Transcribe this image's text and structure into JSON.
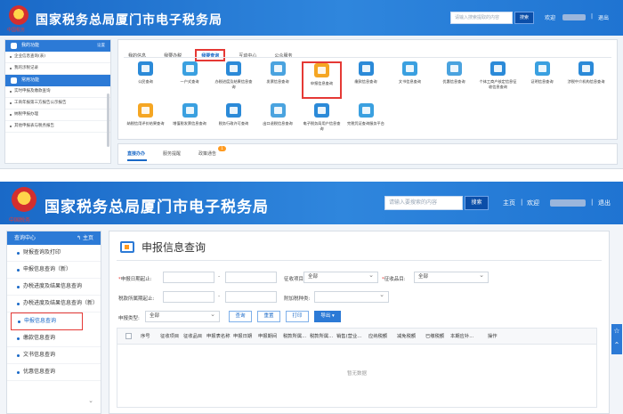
{
  "screenshot1": {
    "header": {
      "title": "国家税务总局厦门市电子税务局",
      "emblem_caption": "中国税务",
      "search_placeholder": "请输入搜索提取的内容",
      "search_button": "搜索",
      "welcome": "欢迎",
      "separator": "|",
      "logout": "退出"
    },
    "sidebar": {
      "section1_title": "我的功能",
      "section1_more": "设置",
      "section1_items": [
        "企业信息查询(表)",
        "我的涉税记录"
      ],
      "section2_title": "常用功能",
      "section2_items": [
        "实时申报及缴款查询",
        "工商年报第三方报告公示报告",
        "纳税申报办理",
        "其他申报表与税务报告"
      ]
    },
    "tabs": [
      "我的信息",
      "我要办税",
      "我要查询",
      "互动中心",
      "公众服务"
    ],
    "active_tab": "我要查询",
    "tiles": [
      {
        "label": "公民查询",
        "color": "#2b8ad8"
      },
      {
        "label": "一户式查询",
        "color": "#3aa0e0"
      },
      {
        "label": "办税进度及结果信息查询",
        "color": "#2b8ad8"
      },
      {
        "label": "发票信息查询",
        "color": "#4aa3df"
      },
      {
        "label": "申报信息查询",
        "color": "#f5a623"
      },
      {
        "label": "缴款信息查询",
        "color": "#2b8ad8"
      },
      {
        "label": "文书信息查询",
        "color": "#3aa0e0"
      },
      {
        "label": "优惠信息查询",
        "color": "#4aa3df"
      },
      {
        "label": "个体工商户核定信息征收信息查询",
        "color": "#2b8ad8"
      },
      {
        "label": "证明信息查询",
        "color": "#3aa0e0"
      },
      {
        "label": "涉税中介机构信息查询",
        "color": "#2b8ad8"
      },
      {
        "label": "纳税信用评价结果查询",
        "color": "#f5a623"
      },
      {
        "label": "增值税发票信息查询",
        "color": "#3aa0e0"
      },
      {
        "label": "税务行政许可查询",
        "color": "#2b8ad8"
      },
      {
        "label": "出口退税信息查询",
        "color": "#4aa3df"
      },
      {
        "label": "电子税务局用户信息查询",
        "color": "#2b8ad8"
      },
      {
        "label": "完税凭证查询服务平台",
        "color": "#3aa0e0"
      }
    ],
    "highlighted_tile": "申报信息查询",
    "bottom_tabs": [
      "直接办办",
      "服务提醒",
      "政策通告"
    ],
    "bottom_badge": "1"
  },
  "screenshot2": {
    "header": {
      "title": "国家税务总局厦门市电子税务局",
      "emblem_caption": "中国税务",
      "search_placeholder": "请输入要搜索的内容",
      "search_button": "搜索",
      "home": "主页",
      "separator": "|",
      "welcome": "欢迎",
      "logout": "退出"
    },
    "sidebar": {
      "title": "查询中心",
      "home": "主页",
      "items": [
        "财报查询及打印",
        "申报信息查询（新）",
        "办税进度及结果信息查询",
        "办税进度及结果信息查询（新）",
        "申报信息查询",
        "缴款信息查询",
        "文书信息查询",
        "优惠信息查询"
      ],
      "selected": "申报信息查询"
    },
    "main": {
      "title": "申报信息查询",
      "labels": {
        "date_range": "申报日期起止:",
        "item": "征收项目:",
        "subitem": "征收品目:",
        "period": "税款所属期起止:",
        "tax_type": "附加税种类:",
        "declare_type": "申报类型:"
      },
      "required_mark": "*",
      "values": {
        "item": "全部",
        "subitem": "全部",
        "declare_type": "全部"
      },
      "buttons": {
        "query": "查询",
        "reset": "重置",
        "print": "打印",
        "export": "导出"
      },
      "table_headers": [
        "序号",
        "征收项目",
        "征收品目",
        "申报表名称",
        "申报日期",
        "申报期间",
        "税款所属...",
        "税款所属...",
        "销售(营业...",
        "应纳税额",
        "减免税额",
        "已缴税额",
        "本期应补...",
        "操作"
      ],
      "empty_text": "暂无数据"
    }
  }
}
